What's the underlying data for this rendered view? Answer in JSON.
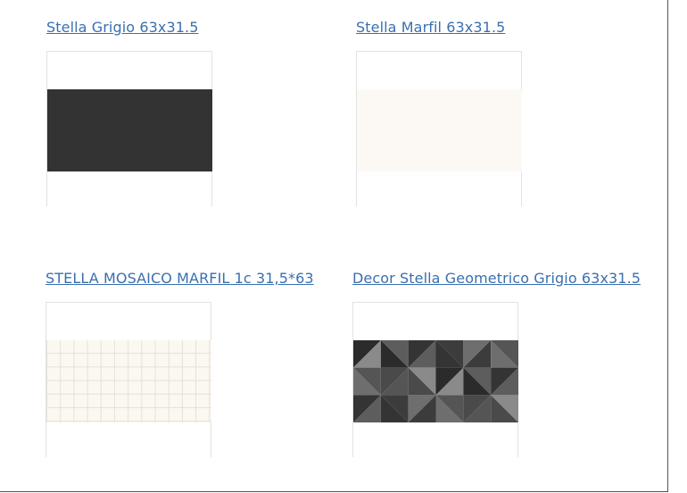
{
  "products": [
    {
      "name": "Stella Grigio 63x31.5",
      "icon": "stella-grigio-tile"
    },
    {
      "name": "Stella Marfil 63x31.5",
      "icon": "stella-marfil-tile"
    },
    {
      "name": "STELLA MOSAICO MARFIL 1c 31,5*63",
      "icon": "stella-mosaico-marfil-tile"
    },
    {
      "name": "Decor Stella Geometrico Grigio 63x31.5",
      "icon": "decor-stella-geometrico-grigio-tile"
    }
  ],
  "colors": {
    "link": "#3a6fb0",
    "grigio": "#333333",
    "marfil": "#fcf9f5"
  }
}
